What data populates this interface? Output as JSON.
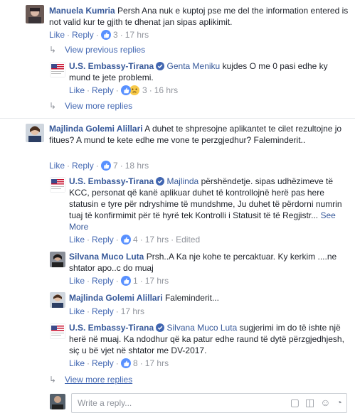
{
  "comments": [
    {
      "author": "Manuela Kumria",
      "text": "Persh Ana nuk e kuptoj pse me del the information entered is not valid kur te gjith te dhenat jan sipas aplikimit.",
      "like_label": "Like",
      "reply_label": "Reply",
      "like_count": "3",
      "time": "17 hrs"
    },
    {
      "author": "U.S. Embassy-Tirana",
      "mention": "Genta Meniku",
      "text": "kujdes O me 0 pasi edhe ky mund te jete problemi.",
      "like_label": "Like",
      "reply_label": "Reply",
      "like_count": "3",
      "time": "16 hrs"
    },
    {
      "author": "Majlinda Golemi Alillari",
      "text": "A duhet te shpresojne aplikantet te cilet rezultojne jo fitues? A mund te kete edhe me vone te perzgjedhur? Faleminderit..",
      "like_label": "Like",
      "reply_label": "Reply",
      "like_count": "7",
      "time": "18 hrs"
    },
    {
      "author": "U.S. Embassy-Tirana",
      "mention": "Majlinda",
      "text": "përshëndetje. sipas udhëzimeve të KCC, personat që kanë aplikuar duhet të kontrollojnë herë pas here statusin e tyre për ndryshime të mundshme, Ju duhet të përdorni numrin tuaj të konfirmimit për të hyrë tek Kontrolli i Statusit të të Regjistr...",
      "see_more": "See More",
      "like_label": "Like",
      "reply_label": "Reply",
      "like_count": "4",
      "time": "17 hrs",
      "edited": "Edited"
    },
    {
      "author": "Silvana Muco Luta",
      "text": "Prsh..A Ka nje kohe te percaktuar. Ky kerkim ....ne shtator apo..c do muaj",
      "like_label": "Like",
      "reply_label": "Reply",
      "like_count": "1",
      "time": "17 hrs"
    },
    {
      "author": "Majlinda Golemi Alillari",
      "text": "Faleminderit...",
      "like_label": "Like",
      "reply_label": "Reply",
      "time": "17 hrs"
    },
    {
      "author": "U.S. Embassy-Tirana",
      "mention": "Silvana Muco Luta",
      "text": "sugjerimi im do të ishte një herë në muaj. Ka ndodhur që ka patur edhe raund të dytë përzgjedhjesh, siç u bë vjet në shtator me DV-2017.",
      "like_label": "Like",
      "reply_label": "Reply",
      "like_count": "8",
      "time": "17 hrs"
    }
  ],
  "view_previous": "View previous replies",
  "view_more_1": "View more replies",
  "view_more_2": "View more replies",
  "reply_placeholder": "Write a reply...",
  "colors": {
    "link": "#365899",
    "action": "#4267b2",
    "meta": "#90949c",
    "verified": "#4267b2"
  }
}
